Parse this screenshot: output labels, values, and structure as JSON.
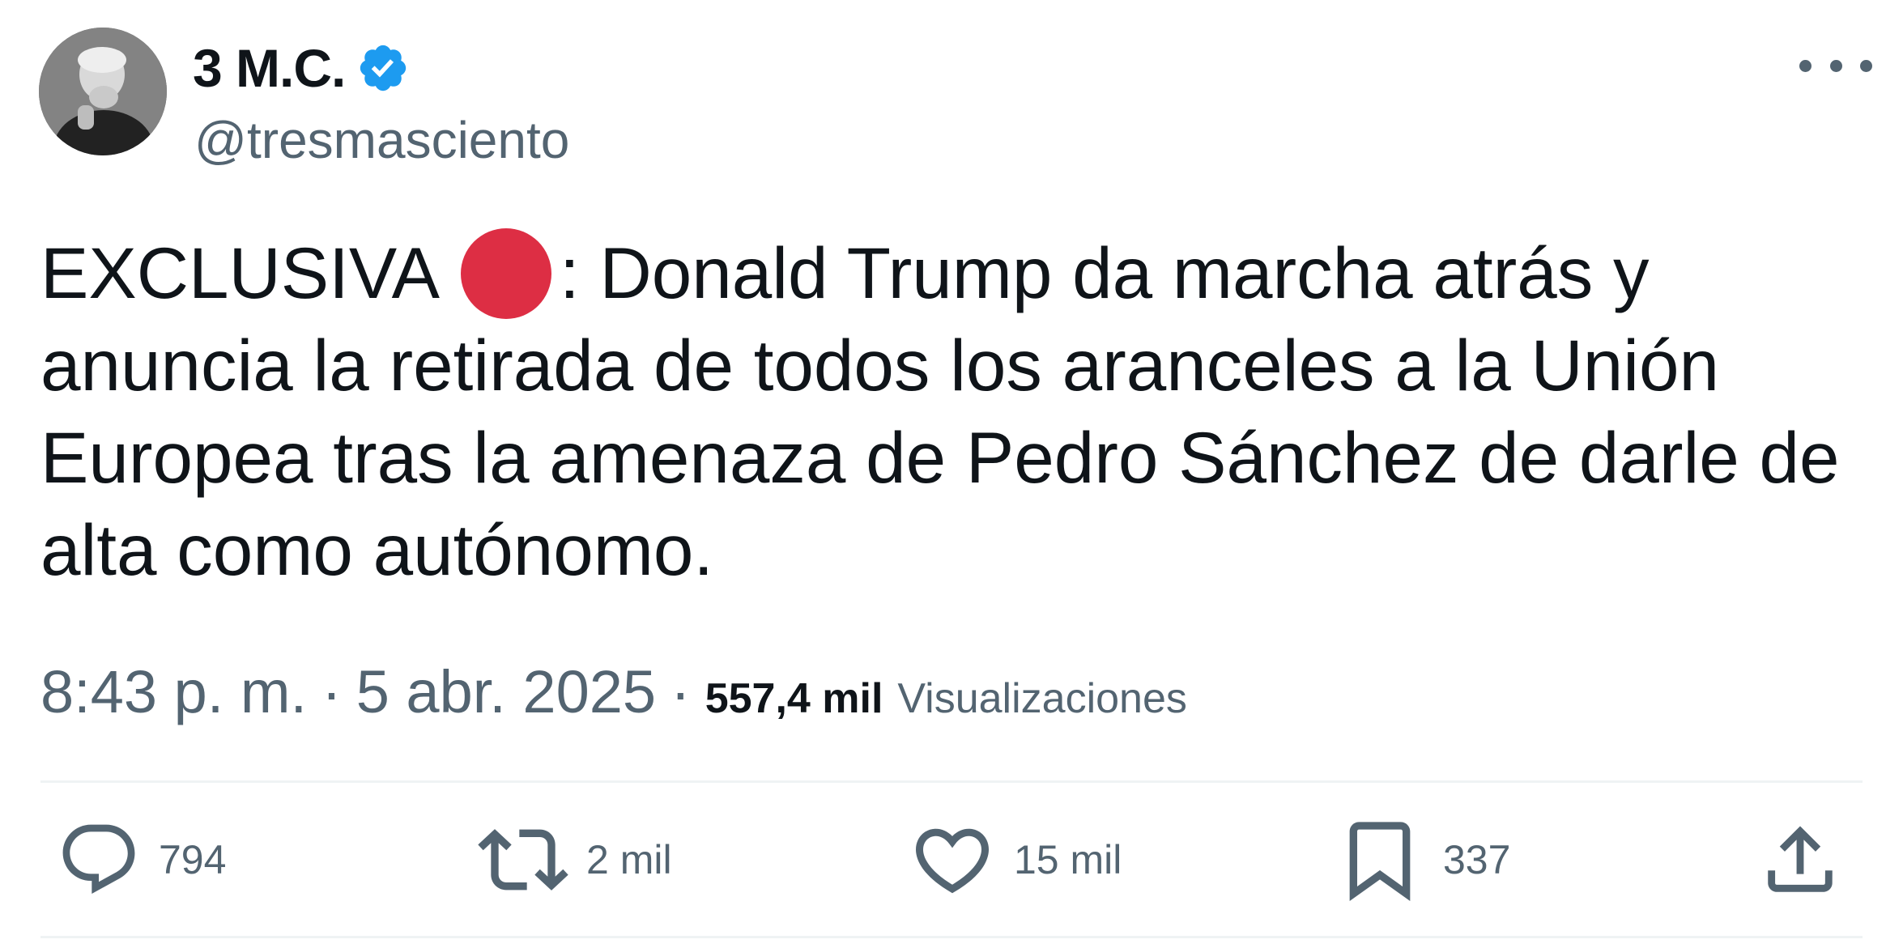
{
  "author": {
    "display_name": "3 M.C.",
    "handle": "@tresmasciento",
    "verified_icon": "verified-badge-icon",
    "avatar_icon": "profile-avatar"
  },
  "tweet": {
    "text_part1": "EXCLUSIVA",
    "emoji": "red-circle-emoji",
    "text_part2": ": Donald Trump da marcha atrás y anuncia la retirada de todos los aranceles a la Unión Europea tras la amenaza de Pedro Sánchez de darle de alta como autónomo."
  },
  "meta": {
    "time": "8:43 p. m.",
    "separator": "·",
    "date": "5 abr. 2025",
    "views_count": "557,4 mil",
    "views_label": "Visualizaciones"
  },
  "actions": {
    "replies": "794",
    "retweets": "2 mil",
    "likes": "15 mil",
    "bookmarks": "337"
  },
  "colors": {
    "text": "#0f1419",
    "secondary": "#536471",
    "verified": "#1d9bf0",
    "red_dot": "#dd2e44",
    "divider": "#eff3f4"
  }
}
